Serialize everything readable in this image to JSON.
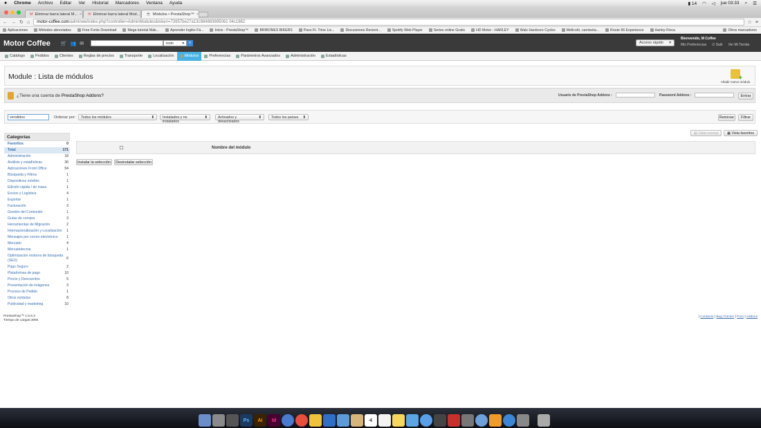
{
  "macbar": {
    "apple": "",
    "menus": [
      "Chrome",
      "Archivo",
      "Editar",
      "Ver",
      "Historial",
      "Marcadores",
      "Ventana",
      "Ayuda"
    ],
    "battery": "14",
    "clock": "jue 03:33"
  },
  "tabs": [
    {
      "label": "Eliminar barra lateral M..."
    },
    {
      "label": "Eliminar barra lateral Mod..."
    },
    {
      "label": "Módulos • PrestaShop™"
    }
  ],
  "address": {
    "domain": "motor-coffee.com",
    "path": "/adminwe/index.php?controller=AdminModules&token=73957be27a13c984883695061 04c1862"
  },
  "bookmarks": [
    "Aplicaciones",
    "Métodos abreviados",
    "Free Fonts Download",
    "Mega tutorial Mak...",
    "Aprender Inglés Fá...",
    "Inicio - PrestaShop™",
    "BRIBONES BIKERS",
    "Pavo Ft. Trine Lix...",
    "Discusiones Recient...",
    "Spotify Web Player",
    "Series online Gratis",
    "HD Motor - HARLEY",
    "Walz Hardcore Cycles",
    "Mellcotó, camiseta...",
    "Route 66 Experience",
    "Harley-Finca"
  ],
  "bookmarks_other": "Otros marcadores",
  "header": {
    "shop_name": "Motor Coffee",
    "search_scope": "todo",
    "quick_access": "Acceso rápido",
    "welcome": "Bienvenido, M Coffee",
    "prefs": "Mis Preferencias",
    "logout": "Salir",
    "view_shop": "Ver Mi Tienda"
  },
  "nav": [
    {
      "label": "Catálogo"
    },
    {
      "label": "Pedidos"
    },
    {
      "label": "Clientes"
    },
    {
      "label": "Reglas de precios"
    },
    {
      "label": "Transporte"
    },
    {
      "label": "Localización"
    },
    {
      "label": "Módulos"
    },
    {
      "label": "Preferencias"
    },
    {
      "label": "Parámetros Avanzados"
    },
    {
      "label": "Administración"
    },
    {
      "label": "Estadísticas"
    }
  ],
  "page": {
    "title": "Module : Lista de módulos",
    "add_module": "Añadir nuevo módulo"
  },
  "addons": {
    "question_prefix": "¿Tiene una cuenta de",
    "question_brand": "PrestaShop Addons?",
    "user_label": "Usuario de PrestaShop Addons :",
    "pass_label": "Password Addons :",
    "login": "Entrar"
  },
  "filters": {
    "search_value": "vendidos",
    "order_label": "Ordenar por:",
    "sel_modules": "Todos los módulos",
    "sel_installed": "Instalados y no instalados",
    "sel_enabled": "Activados y desactivados",
    "sel_countries": "Todos los países",
    "reset": "Reiniciar",
    "filter": "Filtrar"
  },
  "sidebar": {
    "title": "Categorías",
    "items": [
      {
        "label": "Favoritos",
        "count": "0"
      },
      {
        "label": "Total",
        "count": "171"
      },
      {
        "label": "Administración",
        "count": "18"
      },
      {
        "label": "Análisis y estadísticas",
        "count": "30"
      },
      {
        "label": "Aplicaciones Front Office",
        "count": "54"
      },
      {
        "label": "Búsqueda y Filtros",
        "count": "1"
      },
      {
        "label": "Dispositivos móviles",
        "count": "1"
      },
      {
        "label": "Edición rápida / de masa",
        "count": "1"
      },
      {
        "label": "Envíos y Logística",
        "count": "4"
      },
      {
        "label": "Exportar",
        "count": "1"
      },
      {
        "label": "Facturación",
        "count": "3"
      },
      {
        "label": "Gestión del Contenido",
        "count": "1"
      },
      {
        "label": "Guías de compra",
        "count": "3"
      },
      {
        "label": "Herramientas de Migración",
        "count": "2"
      },
      {
        "label": "Internacionalización y Localización",
        "count": "1"
      },
      {
        "label": "Mensajes por correo electrónico",
        "count": "1"
      },
      {
        "label": "Mercado",
        "count": "4"
      },
      {
        "label": "Mercadotecnia",
        "count": "1"
      },
      {
        "label": "Optimización motores de búsqueda (SEO)",
        "count": "6"
      },
      {
        "label": "Pago Seguro",
        "count": "2"
      },
      {
        "label": "Plataformas de pago",
        "count": "10"
      },
      {
        "label": "Precio y Descuentos",
        "count": "5"
      },
      {
        "label": "Presentación de imágenes",
        "count": "3"
      },
      {
        "label": "Proceso de Pedido",
        "count": "1"
      },
      {
        "label": "Otros módulos",
        "count": "8"
      },
      {
        "label": "Publicidad y marketing",
        "count": "10"
      }
    ]
  },
  "view": {
    "normal": "Vista normal",
    "favorites": "Vista favoritos"
  },
  "table": {
    "column_name": "Nombre del módulo",
    "install_selected": "Instalar la selección",
    "uninstall_selected": "Desinstalar selección"
  },
  "footer": {
    "version": "PrestaShop™ 1.5.6.2",
    "load_time": "Tiempo de carga0.309s",
    "links": [
      "Contacto",
      "Bug Tracker",
      "Foro",
      "Addons"
    ]
  },
  "colors": {
    "nav_active": "#49b2e4",
    "header_bg": "#3a3a3a",
    "link": "#3a6fb0"
  }
}
